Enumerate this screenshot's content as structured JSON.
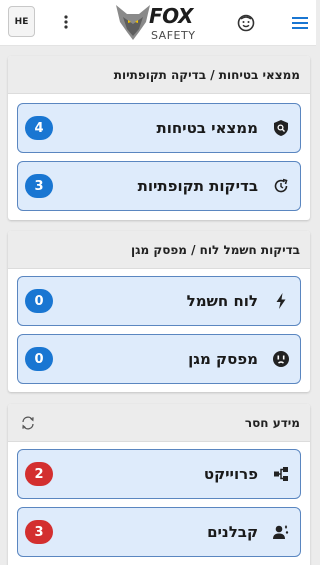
{
  "header": {
    "lang_label": "HE",
    "logo_main": "FOX",
    "logo_sub": "SAFETY"
  },
  "sections": [
    {
      "title": "ממצאי בטיחות / בדיקה תקופתיות",
      "items": [
        {
          "label": "ממצאי בטיחות",
          "count": "4",
          "icon": "shield-icon",
          "badge_color": "#1976d2"
        },
        {
          "label": "בדיקות תקופתיות",
          "count": "3",
          "icon": "refresh-clock-icon",
          "badge_color": "#1976d2"
        }
      ]
    },
    {
      "title": "בדיקות חשמל לוח / מפסק מגן",
      "items": [
        {
          "label": "לוח חשמל",
          "count": "0",
          "icon": "lightning-icon",
          "badge_color": "#1976d2"
        },
        {
          "label": "מפסק מגן",
          "count": "0",
          "icon": "power-outlet-icon",
          "badge_color": "#1976d2"
        }
      ]
    },
    {
      "title": "מידע חסר",
      "items": [
        {
          "label": "פרוייקט",
          "count": "2",
          "icon": "hierarchy-icon",
          "badge_color": "#d32f2f"
        },
        {
          "label": "קבלנים",
          "count": "3",
          "icon": "contractor-icon",
          "badge_color": "#d32f2f"
        }
      ]
    }
  ]
}
